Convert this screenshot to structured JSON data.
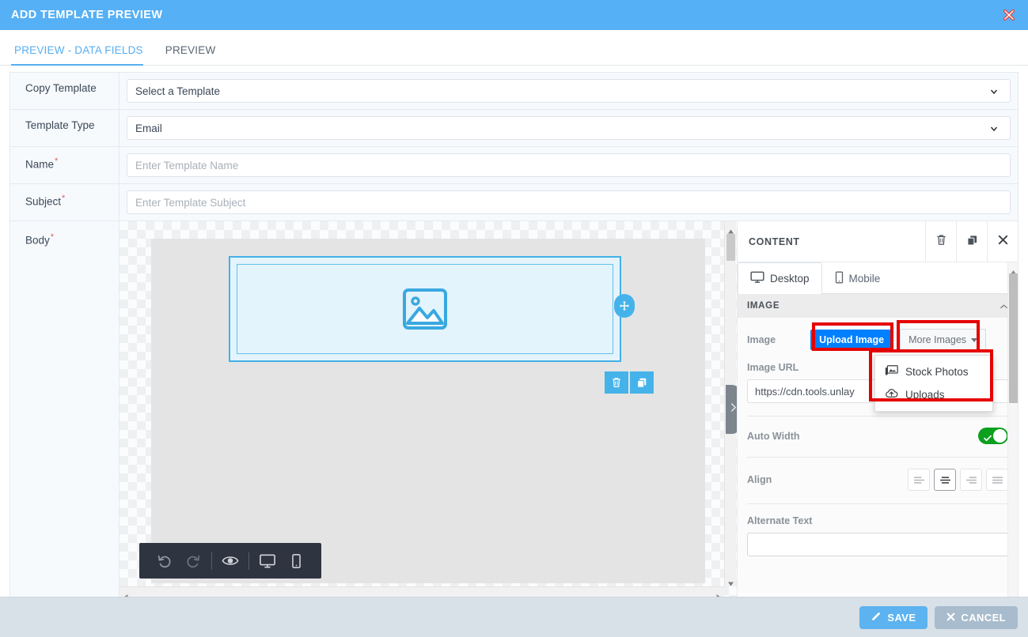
{
  "window": {
    "title": "ADD TEMPLATE PREVIEW",
    "close_icon": "close-icon",
    "accent_color": "#55b0f5",
    "close_color": "#e8433f"
  },
  "tabs": [
    {
      "label": "PREVIEW - DATA FIELDS",
      "active": true
    },
    {
      "label": "PREVIEW",
      "active": false
    }
  ],
  "form": {
    "rows": [
      {
        "label": "Copy Template",
        "required": false,
        "type": "select",
        "value": "Select a Template",
        "is_placeholder": false
      },
      {
        "label": "Template Type",
        "required": false,
        "type": "select",
        "value": "Email",
        "is_placeholder": false
      },
      {
        "label": "Name",
        "required": true,
        "type": "text",
        "value": "",
        "placeholder": "Enter Template Name"
      },
      {
        "label": "Subject",
        "required": true,
        "type": "text",
        "value": "",
        "placeholder": "Enter Template Subject"
      },
      {
        "label": "Body",
        "required": true,
        "type": "editor"
      }
    ],
    "required_mark": "*"
  },
  "editor": {
    "image_block": {
      "placeholder_icon": "image-placeholder-icon",
      "drag_handle_icon": "move-handle-icon",
      "delete_icon": "trash-icon",
      "duplicate_icon": "duplicate-icon",
      "selected_border_color": "#43b0e8",
      "fill_color": "#e3f4fc"
    },
    "toolbar": [
      {
        "name": "undo-icon",
        "title": "Undo"
      },
      {
        "name": "redo-icon",
        "title": "Redo"
      },
      {
        "name": "preview-eye-icon",
        "title": "Preview"
      },
      {
        "name": "desktop-view-icon",
        "title": "Desktop"
      },
      {
        "name": "mobile-view-icon",
        "title": "Mobile"
      }
    ],
    "panel_toggle_icon": "chevron-right-icon",
    "scrollbar": {
      "vertical": true,
      "horizontal": true
    }
  },
  "panel": {
    "title": "CONTENT",
    "head_actions": [
      {
        "name": "trash-icon",
        "label": "Delete"
      },
      {
        "name": "duplicate-icon",
        "label": "Duplicate"
      },
      {
        "name": "close-icon",
        "label": "Close"
      }
    ],
    "device_tabs": [
      {
        "label": "Desktop",
        "icon": "desktop-icon",
        "active": true
      },
      {
        "label": "Mobile",
        "icon": "mobile-icon",
        "active": false
      }
    ],
    "section": {
      "title": "IMAGE",
      "collapse_icon": "chevron-up-icon",
      "expanded": true
    },
    "image_row": {
      "label": "Image",
      "upload_button": "Upload Image",
      "more_button": "More Images",
      "more_caret_icon": "caret-down-icon",
      "upload_button_color": "#0080ff"
    },
    "image_url": {
      "label": "Image URL",
      "value": "https://cdn.tools.unlay"
    },
    "auto_width": {
      "label": "Auto Width",
      "enabled": true,
      "on_color": "#0ca01e"
    },
    "align": {
      "label": "Align",
      "options": [
        {
          "name": "align-left-icon",
          "label": "Left",
          "active": false
        },
        {
          "name": "align-center-icon",
          "label": "Center",
          "active": true
        },
        {
          "name": "align-right-icon",
          "label": "Right",
          "active": false
        },
        {
          "name": "align-justify-icon",
          "label": "Justify",
          "active": false
        }
      ]
    },
    "alternate_text": {
      "label": "Alternate Text",
      "value": ""
    }
  },
  "dropdown": {
    "items": [
      {
        "label": "Stock Photos",
        "icon": "stock-photos-icon"
      },
      {
        "label": "Uploads",
        "icon": "cloud-upload-icon"
      }
    ]
  },
  "annotations": {
    "color": "#e60000",
    "count": 3
  },
  "footer": {
    "save_label": "SAVE",
    "save_icon": "pencil-icon",
    "cancel_label": "CANCEL",
    "cancel_icon": "x-icon"
  }
}
